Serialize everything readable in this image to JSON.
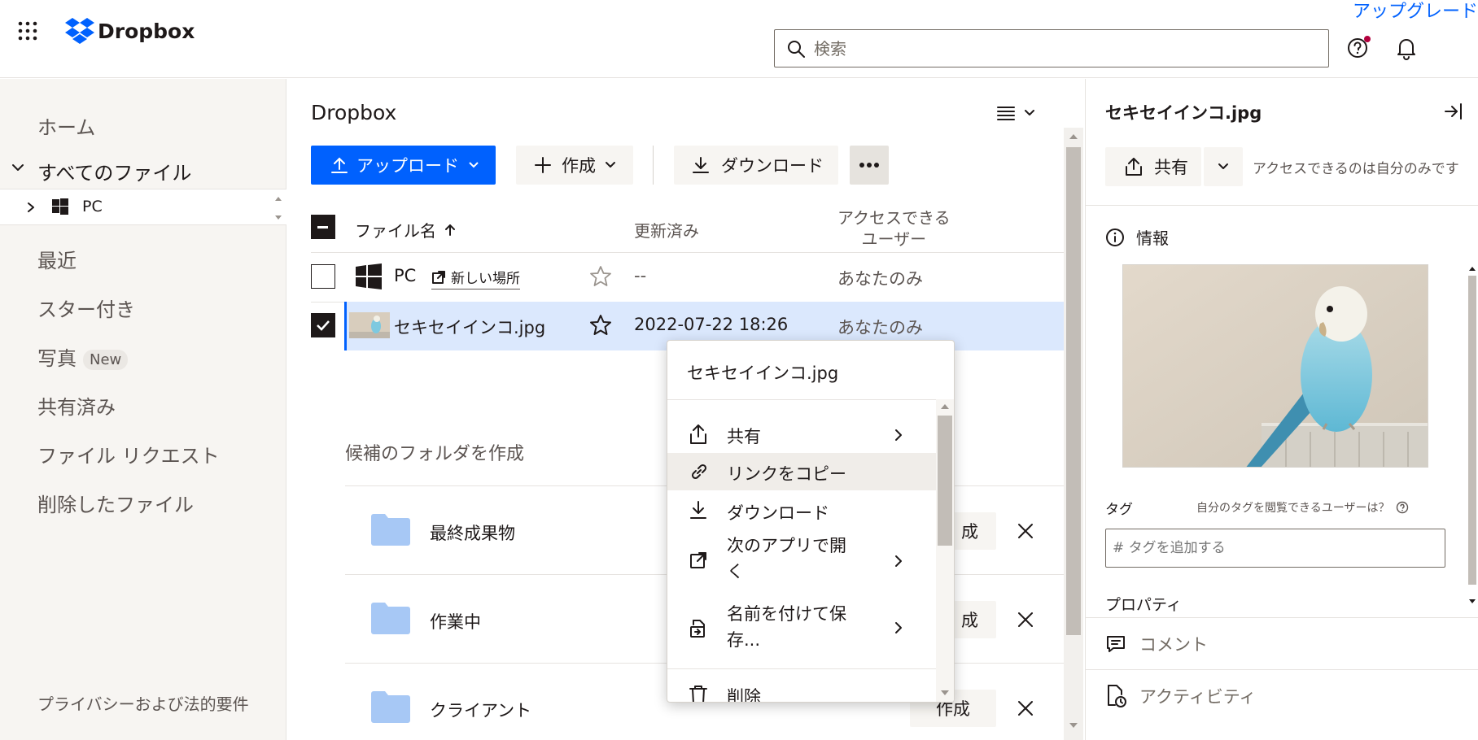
{
  "topbar": {
    "brand": "Dropbox",
    "upgrade_label": "アップグレード",
    "search_placeholder": "検索"
  },
  "sidebar": {
    "items": [
      {
        "label": "ホーム"
      },
      {
        "label": "すべてのファイル"
      },
      {
        "label": "PC"
      },
      {
        "label": "最近"
      },
      {
        "label": "スター付き"
      },
      {
        "label": "写真",
        "badge": "New"
      },
      {
        "label": "共有済み"
      },
      {
        "label": "ファイル リクエスト"
      },
      {
        "label": "削除したファイル"
      }
    ],
    "footer": "プライバシーおよび法的要件"
  },
  "main": {
    "title": "Dropbox",
    "toolbar": {
      "upload": "アップロード",
      "create": "作成",
      "download": "ダウンロード"
    },
    "columns": {
      "name": "ファイル名",
      "modified": "更新済み",
      "access_line1": "アクセスできる",
      "access_line2": "ユーザー"
    },
    "rows": [
      {
        "name": "PC",
        "tag": "新しい場所",
        "modified": "--",
        "access": "あなたのみ"
      },
      {
        "name": "セキセイインコ.jpg",
        "modified": "2022-07-22 18:26",
        "access": "あなたのみ"
      }
    ],
    "suggestions": {
      "heading": "候補のフォルダを作成",
      "create_label": "作成",
      "folders": [
        {
          "name": "最終成果物",
          "button_visible": "成"
        },
        {
          "name": "作業中",
          "button_visible": "成"
        },
        {
          "name": "クライアント",
          "button_visible": "作成"
        }
      ]
    }
  },
  "context_menu": {
    "title": "セキセイインコ.jpg",
    "items": [
      {
        "label": "共有"
      },
      {
        "label": "リンクをコピー"
      },
      {
        "label": "ダウンロード"
      },
      {
        "label_line1": "次のアプリで開",
        "label_line2": "く"
      },
      {
        "label_line1": "名前を付けて保",
        "label_line2": "存..."
      },
      {
        "label": "削除"
      }
    ]
  },
  "details": {
    "filename": "セキセイインコ.jpg",
    "share_label": "共有",
    "access_note": "アクセスできるのは自分のみです",
    "info_label": "情報",
    "tags_label": "タグ",
    "tags_help": "自分のタグを閲覧できるユーザーは？",
    "tag_placeholder": "# タグを追加する",
    "properties_label": "プロパティ",
    "comment_label": "コメント",
    "activity_label": "アクティビティ"
  },
  "colors": {
    "accent": "#0061fe",
    "selected_row": "#dbe8fd",
    "sidebar_bg": "#f7f5f2",
    "text": "#1e1919",
    "secondary_text": "#5c5552",
    "folder": "#a7c8f5",
    "notification_dot": "#b2003d"
  }
}
